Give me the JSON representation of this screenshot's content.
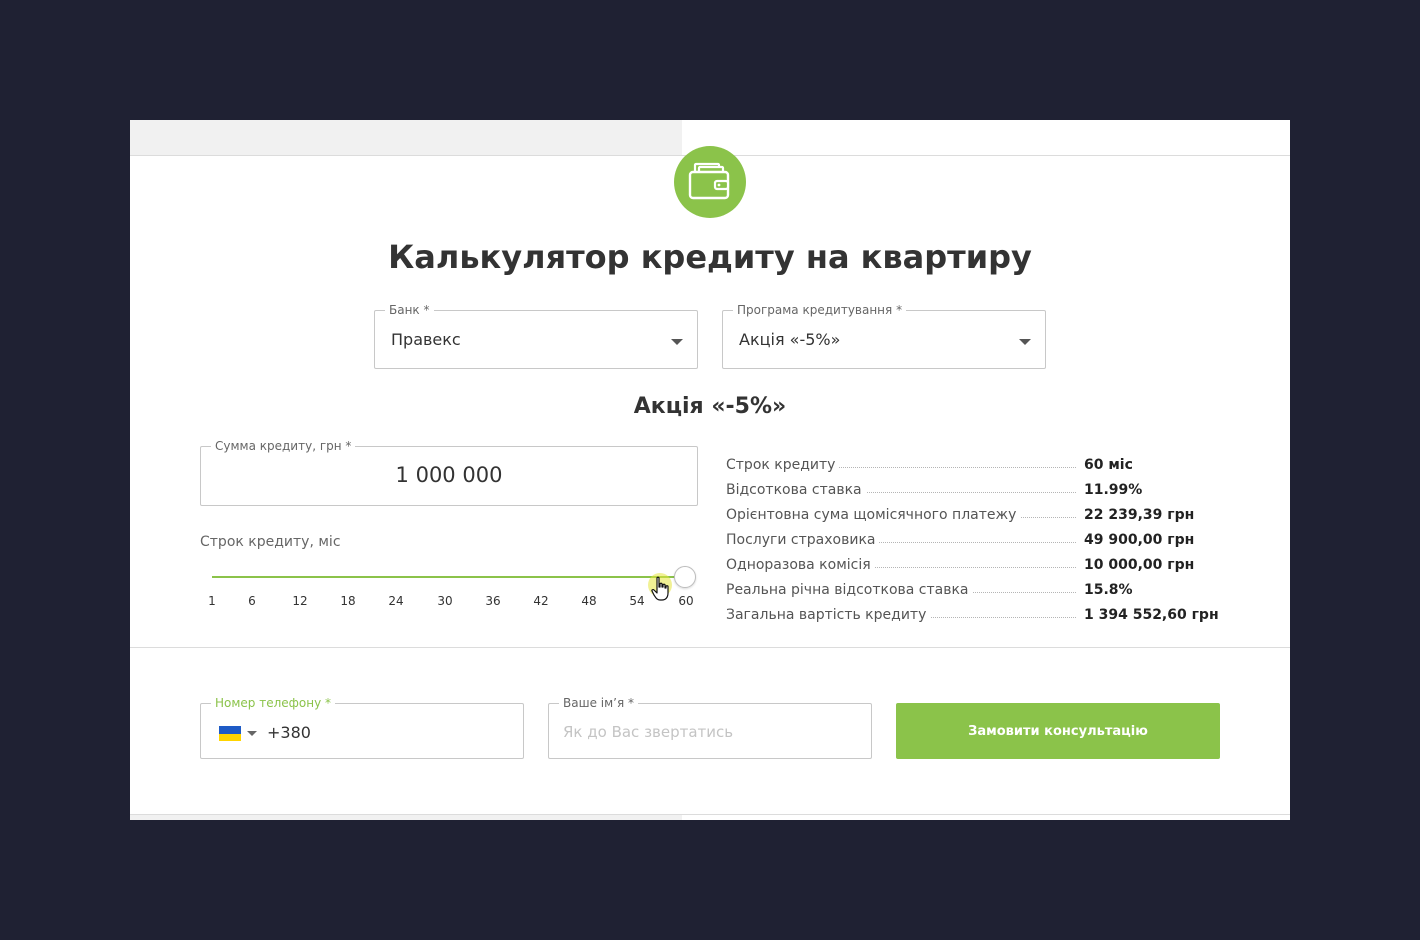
{
  "title": "Калькулятор кредиту на квартиру",
  "bank": {
    "label": "Банк *",
    "value": "Правекс"
  },
  "program": {
    "label": "Програма кредитування *",
    "value": "Акція «-5%»"
  },
  "program_title": "Акція «-5%»",
  "amount": {
    "label": "Сумма кредиту, грн *",
    "value": "1 000 000"
  },
  "term": {
    "label": "Строк кредиту, міс",
    "ticks": [
      "1",
      "6",
      "12",
      "18",
      "24",
      "30",
      "36",
      "42",
      "48",
      "54",
      "60"
    ],
    "selected_value": 60
  },
  "summary": [
    {
      "label": "Строк кредиту",
      "value": "60 міс"
    },
    {
      "label": "Відсоткова ставка",
      "value": "11.99%"
    },
    {
      "label": "Орієнтовна сума щомісячного платежу",
      "value": "22 239,39 грн"
    },
    {
      "label": "Послуги страховика",
      "value": "49 900,00 грн"
    },
    {
      "label": "Одноразова комісія",
      "value": "10 000,00 грн"
    },
    {
      "label": "Реальна річна відсоткова ставка",
      "value": "15.8%"
    },
    {
      "label": "Загальна вартість кредиту",
      "value": "1 394 552,60 грн"
    }
  ],
  "phone": {
    "label": "Номер телефону *",
    "value": "+380",
    "flag": "ukraine-flag-icon"
  },
  "name": {
    "label": "Ваше ім’я *",
    "placeholder": "Як до Вас звертатись"
  },
  "submit_label": "Замовити консультацію",
  "colors": {
    "accent": "#8bc34a",
    "background": "#1f2133",
    "card": "#ffffff"
  }
}
